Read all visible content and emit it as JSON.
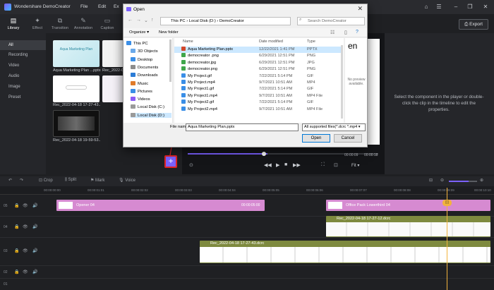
{
  "app": {
    "title": "Wondershare DemoCreator",
    "menu": [
      "File",
      "Edit",
      "Ex"
    ],
    "export_label": "Export",
    "window_controls": [
      "minimize-icon",
      "restore-icon",
      "close-icon"
    ]
  },
  "tabs": [
    {
      "label": "Library",
      "icon": "library-icon",
      "active": true
    },
    {
      "label": "Effect",
      "icon": "effect-icon",
      "active": false
    },
    {
      "label": "Transition",
      "icon": "transition-icon",
      "active": false
    },
    {
      "label": "Annotation",
      "icon": "annotation-icon",
      "active": false
    },
    {
      "label": "Caption",
      "icon": "caption-icon",
      "active": false
    }
  ],
  "library_nav": [
    "All",
    "Recording",
    "Video",
    "Audio",
    "Image",
    "Preset"
  ],
  "media": [
    {
      "label": "Aqua Marketing Plan ...pptx",
      "thumb_text": "Aqua Marketing Plan"
    },
    {
      "label": "Rec_2022-04-18 17-27-43..."
    },
    {
      "label": "Rec_2022-04-18 17-27-43..."
    },
    {
      "label": "Rec_2022-04-18 19-59-53..."
    }
  ],
  "properties_hint": "Select the component in the player or double-click the clip in the timeline to edit the properties.",
  "player": {
    "time_current": "00:00:09",
    "time_total": "00:00:18",
    "fit_label": "Fit",
    "import_button": "+"
  },
  "toolbar": {
    "crop": "Crop",
    "split": "Split",
    "mark": "Mark",
    "voice": "Voice"
  },
  "ruler_ticks": [
    "00:00:00:00",
    "00:00:01:01",
    "00:00:02:02",
    "00:00:03:03",
    "00:00:04:04",
    "00:00:05:05",
    "00:00:06:06",
    "00:00:07:07",
    "00:00:08:08",
    "00:00:09:09",
    "00:00:10:10"
  ],
  "tracks": [
    {
      "num": "05"
    },
    {
      "num": "04"
    },
    {
      "num": "03"
    },
    {
      "num": "02"
    },
    {
      "num": "01"
    }
  ],
  "clips": {
    "opener": {
      "label": "Opener 04",
      "time": "00:00:05:00"
    },
    "office": {
      "label": "Office Pack Lowerthird 04"
    },
    "rec_top": {
      "label": "Rec_2022-04-18 17-27-12.dcrc"
    },
    "rec_main": {
      "label": "Rec_2022-04-18 17-27-43.dcrc"
    }
  },
  "dialog": {
    "title": "Open",
    "address": [
      "This PC",
      "Local Disk (D:)",
      "DemoCreator"
    ],
    "search_placeholder": "Search DemoCreator",
    "organize": "Organize ▾",
    "new_folder": "New folder",
    "tree": [
      {
        "label": "This PC",
        "icon": "computer-icon",
        "color": "#3a8ee6"
      },
      {
        "label": "3D Objects",
        "icon": "cube-icon",
        "color": "#6aa9e9"
      },
      {
        "label": "Desktop",
        "icon": "desktop-icon",
        "color": "#3a8ee6"
      },
      {
        "label": "Documents",
        "icon": "documents-icon",
        "color": "#8c8c8c"
      },
      {
        "label": "Downloads",
        "icon": "download-icon",
        "color": "#2c7cd6"
      },
      {
        "label": "Music",
        "icon": "music-icon",
        "color": "#e07b2a"
      },
      {
        "label": "Pictures",
        "icon": "pictures-icon",
        "color": "#3a8ee6"
      },
      {
        "label": "Videos",
        "icon": "videos-icon",
        "color": "#8b5cf6"
      },
      {
        "label": "Local Disk (C:)",
        "icon": "drive-icon",
        "color": "#9a9a9a"
      },
      {
        "label": "Local Disk (D:)",
        "icon": "drive-icon",
        "color": "#9a9a9a",
        "selected": true
      }
    ],
    "columns": {
      "name": "Name",
      "date": "Date modified",
      "type": "Type"
    },
    "files": [
      {
        "name": "Aqua Marketing Plan.pptx",
        "date": "12/22/2021 1:41 PM",
        "type": "PPTX",
        "color": "#d2472a",
        "selected": true
      },
      {
        "name": "democreator .png",
        "date": "6/29/2021 12:51 PM",
        "type": "PNG",
        "color": "#3fa64b"
      },
      {
        "name": "democreator.jpg",
        "date": "6/29/2021 12:51 PM",
        "type": "JPG",
        "color": "#3fa64b"
      },
      {
        "name": "democreator.png",
        "date": "6/29/2021 12:51 PM",
        "type": "PNG",
        "color": "#3fa64b"
      },
      {
        "name": "My Project.gif",
        "date": "7/22/2021 5:14 PM",
        "type": "GIF",
        "color": "#3a8ee6"
      },
      {
        "name": "My Project.mp4",
        "date": "9/7/2021 10:51 AM",
        "type": "MP4",
        "color": "#3a8ee6"
      },
      {
        "name": "My Project1.gif",
        "date": "7/22/2021 5:14 PM",
        "type": "GIF",
        "color": "#3a8ee6"
      },
      {
        "name": "My Project1.mp4",
        "date": "9/7/2021 10:51 AM",
        "type": "MP4 File",
        "color": "#3a8ee6"
      },
      {
        "name": "My Project2.gif",
        "date": "7/22/2021 5:14 PM",
        "type": "GIF",
        "color": "#3a8ee6"
      },
      {
        "name": "My Project2.mp4",
        "date": "9/7/2021 10:51 AM",
        "type": "MP4 File",
        "color": "#3a8ee6"
      }
    ],
    "no_preview": "No preview available.",
    "preview_word": "en",
    "file_name_label": "File name:",
    "file_name_value": "Aqua Marketing Plan.pptx",
    "file_type_value": "All supported files(*.dcrc *.mp4 ▾",
    "open_button": "Open",
    "cancel_button": "Cancel"
  },
  "colors": {
    "accent": "#7b61ff",
    "highlight_border": "#e02424",
    "clip_pink": "#d68ad1",
    "clip_olive": "#7e8a3f",
    "playhead": "#f2b33d"
  }
}
